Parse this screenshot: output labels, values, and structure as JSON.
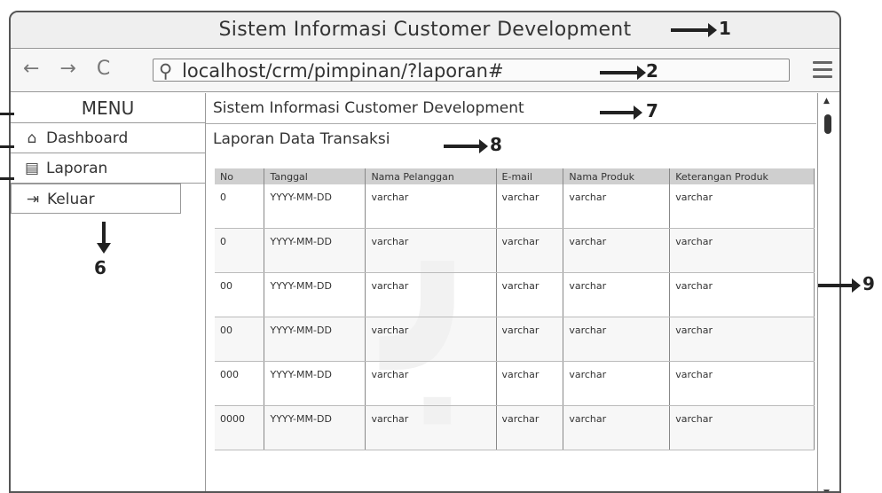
{
  "watermark": "ﺑ",
  "window": {
    "title": "Sistem Informasi Customer Development"
  },
  "addressbar": {
    "nav": "← → C",
    "search_icon": "search-icon",
    "url": "localhost/crm/pimpinan/?laporan#"
  },
  "sidebar": {
    "menu_label": "MENU",
    "items": [
      {
        "icon": "home-icon",
        "label": "Dashboard"
      },
      {
        "icon": "document-icon",
        "label": "Laporan"
      },
      {
        "icon": "logout-icon",
        "label": "Keluar"
      }
    ]
  },
  "content": {
    "title": "Sistem Informasi Customer Development",
    "subtitle": "Laporan Data Transaksi",
    "table": {
      "headers": [
        "No",
        "Tanggal",
        "Nama Pelanggan",
        "E-mail",
        "Nama Produk",
        "Keterangan Produk"
      ],
      "rows": [
        [
          "0",
          "YYYY-MM-DD",
          "varchar",
          "varchar",
          "varchar",
          "varchar"
        ],
        [
          "0",
          "YYYY-MM-DD",
          "varchar",
          "varchar",
          "varchar",
          "varchar"
        ],
        [
          "00",
          "YYYY-MM-DD",
          "varchar",
          "varchar",
          "varchar",
          "varchar"
        ],
        [
          "00",
          "YYYY-MM-DD",
          "varchar",
          "varchar",
          "varchar",
          "varchar"
        ],
        [
          "000",
          "YYYY-MM-DD",
          "varchar",
          "varchar",
          "varchar",
          "varchar"
        ],
        [
          "0000",
          "YYYY-MM-DD",
          "varchar",
          "varchar",
          "varchar",
          "varchar"
        ]
      ]
    }
  },
  "annotations": {
    "n1": "1",
    "n2": "2",
    "n6": "6",
    "n7": "7",
    "n8": "8",
    "n9": "9"
  }
}
